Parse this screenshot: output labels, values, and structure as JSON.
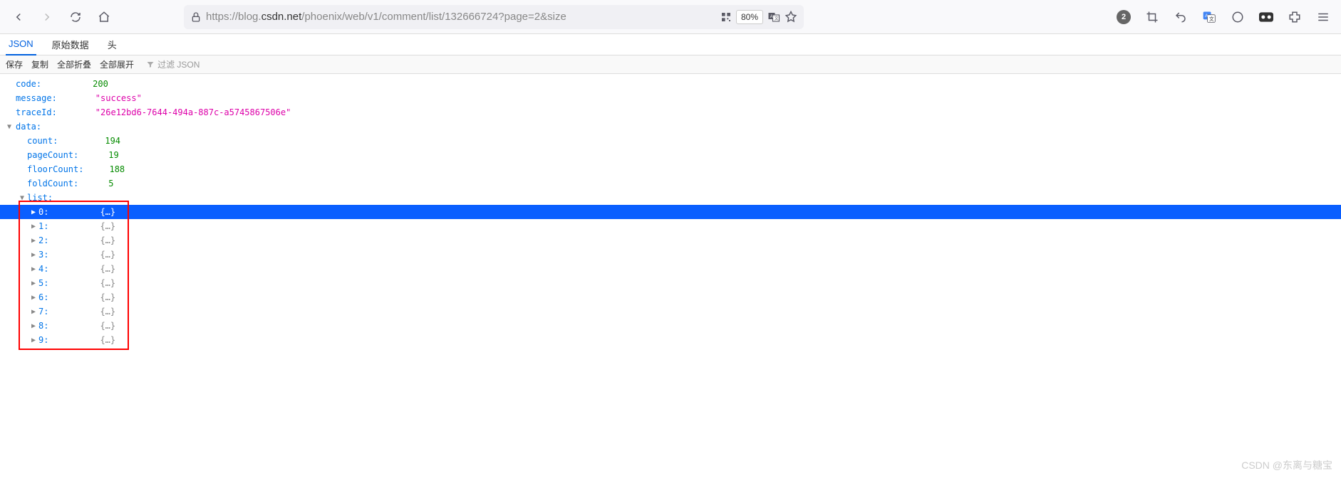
{
  "browser": {
    "url_prefix": "https://blog.",
    "url_domain": "csdn.net",
    "url_path": "/phoenix/web/v1/comment/list/132666724?page=2&size",
    "zoom": "80%",
    "badge_count": "2"
  },
  "tabs": {
    "json": "JSON",
    "raw": "原始数据",
    "headers": "头"
  },
  "toolbar": {
    "save": "保存",
    "copy": "复制",
    "collapse_all": "全部折叠",
    "expand_all": "全部展开",
    "filter_placeholder": "过滤 JSON"
  },
  "json": {
    "code_key": "code:",
    "code_val": "200",
    "message_key": "message:",
    "message_val": "\"success\"",
    "traceId_key": "traceId:",
    "traceId_val": "\"26e12bd6-7644-494a-887c-a5745867506e\"",
    "data_key": "data:",
    "count_key": "count:",
    "count_val": "194",
    "pageCount_key": "pageCount:",
    "pageCount_val": "19",
    "floorCount_key": "floorCount:",
    "floorCount_val": "188",
    "foldCount_key": "foldCount:",
    "foldCount_val": "5",
    "list_key": "list:",
    "items": [
      {
        "key": "0:",
        "val": "{…}"
      },
      {
        "key": "1:",
        "val": "{…}"
      },
      {
        "key": "2:",
        "val": "{…}"
      },
      {
        "key": "3:",
        "val": "{…}"
      },
      {
        "key": "4:",
        "val": "{…}"
      },
      {
        "key": "5:",
        "val": "{…}"
      },
      {
        "key": "6:",
        "val": "{…}"
      },
      {
        "key": "7:",
        "val": "{…}"
      },
      {
        "key": "8:",
        "val": "{…}"
      },
      {
        "key": "9:",
        "val": "{…}"
      }
    ]
  },
  "watermark": "CSDN @东离与糖宝"
}
